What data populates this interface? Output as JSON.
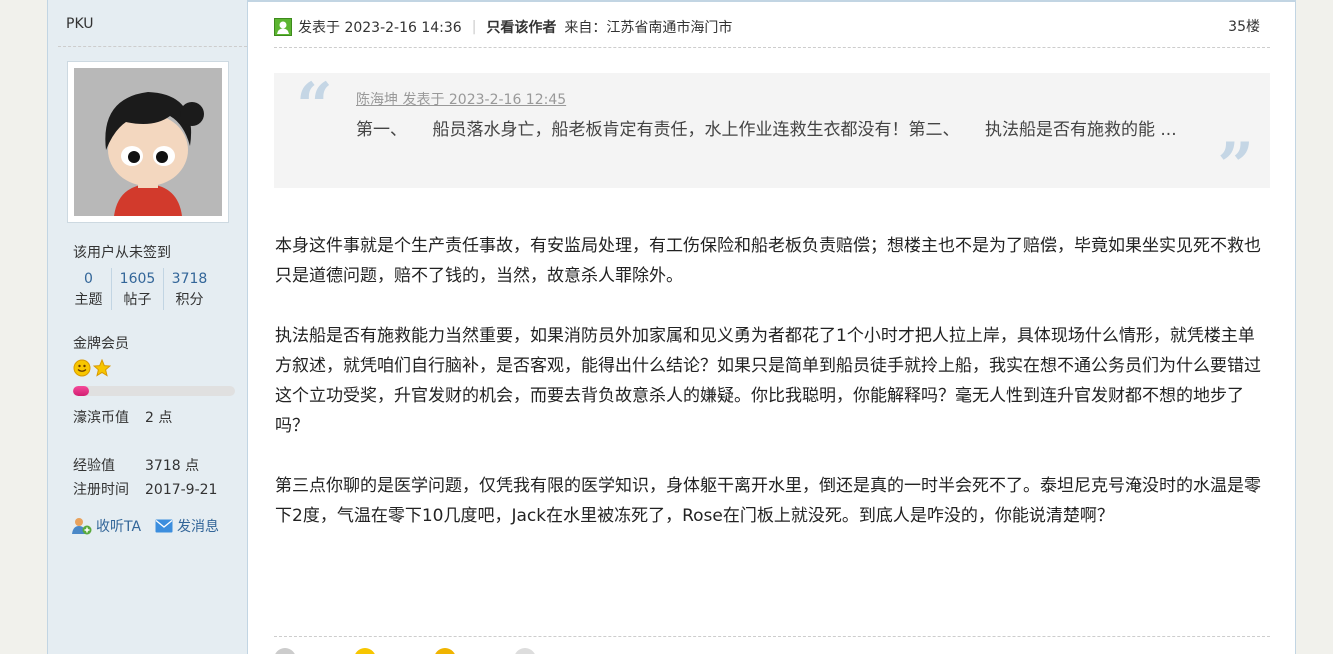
{
  "sidebar": {
    "username": "PKU",
    "sign_status": "该用户从未签到",
    "stats": [
      {
        "value": "0",
        "label": "主题"
      },
      {
        "value": "1605",
        "label": "帖子"
      },
      {
        "value": "3718",
        "label": "积分"
      }
    ],
    "group": "金牌会员",
    "group_progress": 0.1,
    "haobin": {
      "label": "濠滨币值",
      "value": "2 点"
    },
    "exp": {
      "label": "经验值",
      "value": "3718 点"
    },
    "register": {
      "label": "注册时间",
      "value": "2017-9-21"
    },
    "follow_label": "收听TA",
    "message_label": "发消息"
  },
  "post": {
    "posted_at": "发表于 2023-2-16 14:36",
    "only_author": "只看该作者",
    "from": "来自：江苏省南通市海门市",
    "floor": "35楼",
    "quote": {
      "meta": "陈海坤 发表于 2023-2-16 12:45",
      "text": "第一、　　船员落水身亡，船老板肯定有责任，水上作业连救生衣都没有！第二、　　执法船是否有施救的能 ..."
    },
    "paragraphs": [
      "本身这件事就是个生产责任事故，有安监局处理，有工伤保险和船老板负责赔偿；想楼主也不是为了赔偿，毕竟如果坐实见死不救也只是道德问题，赔不了钱的，当然，故意杀人罪除外。",
      "执法船是否有施救能力当然重要，如果消防员外加家属和见义勇为者都花了1个小时才把人拉上岸，具体现场什么情形，就凭楼主单方叙述，就凭咱们自行脑补，是否客观，能得出什么结论？如果只是简单到船员徒手就拎上船，我实在想不通公务员们为什么要错过这个立功受奖，升官发财的机会，而要去背负故意杀人的嫌疑。你比我聪明，你能解释吗？毫无人性到连升官发财都不想的地步了吗？",
      "第三点你聊的是医学问题，仅凭我有限的医学知识，身体躯干离开水里，倒还是真的一时半会死不了。泰坦尼克号淹没时的水温是零下2度，气温在零下10几度吧，Jack在水里被冻死了，Rose在门板上就没死。到底人是咋没的，你能说清楚啊？"
    ]
  }
}
